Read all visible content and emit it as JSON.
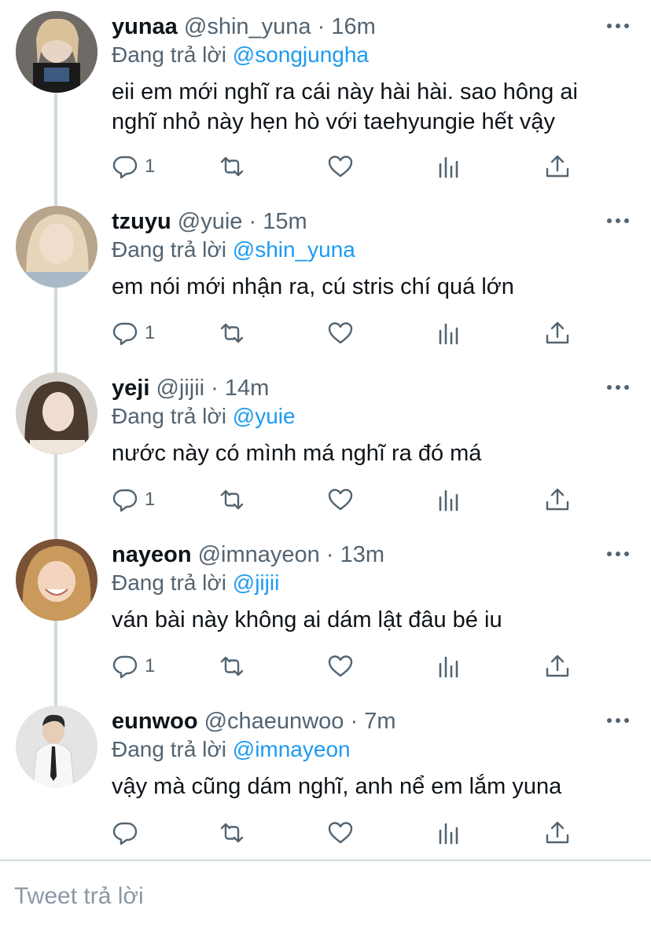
{
  "tweets": [
    {
      "name": "yunaa",
      "handle": "@shin_yuna",
      "dot": "·",
      "time": "16m",
      "reply_label": "Đang trả lời",
      "reply_mention": "@songjungha",
      "text": "eii em mới nghĩ ra cái này hài hài. sao hông ai nghĩ nhỏ này hẹn hò với taehyungie hết vậy",
      "reply_count": "1"
    },
    {
      "name": "tzuyu",
      "handle": "@yuie",
      "dot": "·",
      "time": "15m",
      "reply_label": "Đang trả lời",
      "reply_mention": "@shin_yuna",
      "text": "em nói mới nhận ra, cú stris chí quá lớn",
      "reply_count": "1"
    },
    {
      "name": "yeji",
      "handle": "@jijii",
      "dot": "·",
      "time": "14m",
      "reply_label": "Đang trả lời",
      "reply_mention": "@yuie",
      "text": "nước này có mình má nghĩ ra đó má",
      "reply_count": "1"
    },
    {
      "name": "nayeon",
      "handle": "@imnayeon",
      "dot": "·",
      "time": "13m",
      "reply_label": "Đang trả lời",
      "reply_mention": "@jijii",
      "text": "ván bài này không ai dám lật đâu bé iu",
      "reply_count": "1"
    },
    {
      "name": "eunwoo",
      "handle": "@chaeunwoo",
      "dot": "·",
      "time": "7m",
      "reply_label": "Đang trả lời",
      "reply_mention": "@imnayeon",
      "text": "vậy mà cũng dám nghĩ, anh nể em lắm yuna",
      "reply_count": ""
    }
  ],
  "composer": {
    "placeholder": "Tweet trả lời"
  },
  "icons": {
    "more": "more-horizontal-icon",
    "reply": "reply-bubble-icon",
    "retweet": "retweet-icon",
    "like": "heart-icon",
    "analytics": "analytics-bars-icon",
    "share": "share-upload-icon"
  },
  "colors": {
    "accent": "#1d9bf0",
    "secondary_text": "#536471",
    "thread_line": "#cfd9de"
  }
}
